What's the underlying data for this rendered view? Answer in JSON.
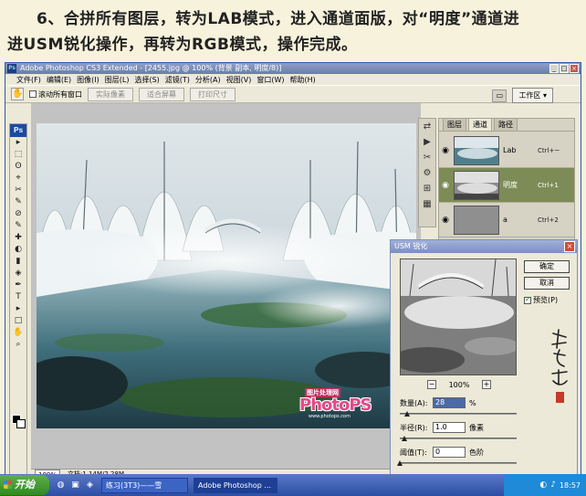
{
  "caption": {
    "line1": "6、合拼所有图层，转为LAB模式，进入通道面版，对“明度”通道进",
    "line2": "进USM锐化操作，再转为RGB模式，操作完成。"
  },
  "window": {
    "title": "Adobe Photoshop CS3 Extended - [2455.jpg @ 100% (背景 副本, 明度/8)]",
    "logo": "Ps",
    "controls": [
      "_",
      "□",
      "×"
    ]
  },
  "menu": [
    "文件(F)",
    "编辑(E)",
    "图像(I)",
    "图层(L)",
    "选择(S)",
    "滤镜(T)",
    "分析(A)",
    "视图(V)",
    "窗口(W)",
    "帮助(H)"
  ],
  "options": {
    "scroll_all": "滚动所有窗口",
    "actual_pixels": "实际像素",
    "fit_screen": "适合屏幕",
    "print_size": "打印尺寸",
    "workspace": "工作区 ▾"
  },
  "toolbox": {
    "logo": "Ps",
    "tools": [
      "▸",
      "⬚",
      "ʘ",
      "⌖",
      "✂",
      "✎",
      "⊘",
      "✎",
      "✚",
      "◐",
      "▮",
      "◈",
      "✒",
      "T",
      "▸",
      "□",
      "✋",
      "⌕"
    ]
  },
  "watermark": {
    "top": "图片处理网",
    "main": "PhotoPS",
    "url": "www.photops.com"
  },
  "status": {
    "zoom": "100%",
    "doc": "文档:1.14M/2.28M"
  },
  "panel": {
    "tabs": [
      "图层",
      "通道",
      "路径"
    ],
    "active_tab": 1,
    "channels": [
      {
        "name": "Lab",
        "shortcut": "Ctrl+~"
      },
      {
        "name": "明度",
        "shortcut": "Ctrl+1"
      },
      {
        "name": "a",
        "shortcut": "Ctrl+2"
      }
    ]
  },
  "icon_strip": [
    "⇄",
    "▶",
    "✂",
    "⚙",
    "⊞",
    "▦"
  ],
  "usm": {
    "title": "USM 锐化",
    "ok": "确定",
    "cancel": "取消",
    "preview_label": "预览(P)",
    "zoom": "100%",
    "zoom_minus": "−",
    "zoom_plus": "+",
    "amount_label": "数量(A):",
    "amount_value": "28",
    "amount_unit": "%",
    "amount_fraction": 0.06,
    "radius_label": "半径(R):",
    "radius_value": "1.0",
    "radius_unit": "像素",
    "radius_fraction": 0.04,
    "threshold_label": "阈值(T):",
    "threshold_value": "0",
    "threshold_unit": "色阶",
    "threshold_fraction": 0.0
  },
  "taskbar": {
    "start": "开始",
    "items": [
      "练习(3T3)——雪",
      "Adobe Photoshop ..."
    ],
    "clock": "18:57"
  }
}
